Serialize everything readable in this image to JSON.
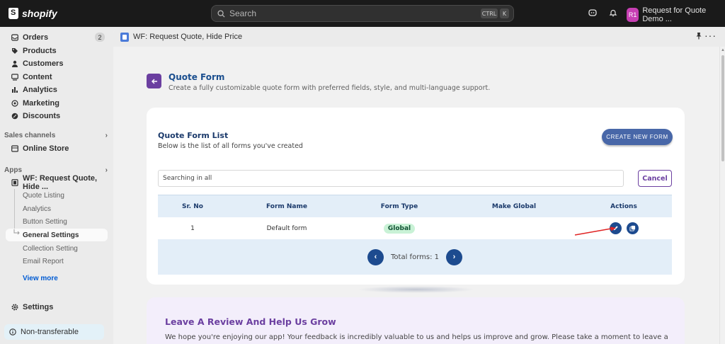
{
  "topbar": {
    "brand": "shopify",
    "search_placeholder": "Search",
    "shortcut_ctrl": "CTRL",
    "shortcut_k": "K",
    "store_initials": "R1",
    "store_name": "Request for Quote Demo ..."
  },
  "sidebar": {
    "nav": [
      {
        "label": "Orders",
        "badge": "2",
        "icon": "inbox-icon"
      },
      {
        "label": "Products",
        "icon": "tag-icon"
      },
      {
        "label": "Customers",
        "icon": "person-icon"
      },
      {
        "label": "Content",
        "icon": "content-icon"
      },
      {
        "label": "Analytics",
        "icon": "bar-chart-icon"
      },
      {
        "label": "Marketing",
        "icon": "target-icon"
      },
      {
        "label": "Discounts",
        "icon": "discount-icon"
      }
    ],
    "sales_channels_title": "Sales channels",
    "online_store": "Online Store",
    "apps_title": "Apps",
    "app_name": "WF: Request Quote, Hide ...",
    "app_subitems": [
      "Quote Listing",
      "Analytics",
      "Button Setting",
      "General Settings",
      "Collection Setting",
      "Email Report"
    ],
    "active_subitem_index": 3,
    "view_more": "View more",
    "settings": "Settings",
    "non_transferable": "Non-transferable"
  },
  "main": {
    "header_title": "WF: Request Quote, Hide Price",
    "quote_form": {
      "title": "Quote Form",
      "description": "Create a fully customizable quote form with preferred fields, style, and multi-language support."
    },
    "list": {
      "title": "Quote Form List",
      "description": "Below is the list of all forms you've created",
      "create_button": "CREATE NEW FORM",
      "search_placeholder": "Searching in all",
      "cancel_button": "Cancel",
      "columns": [
        "Sr. No",
        "Form Name",
        "Form Type",
        "Make Global",
        "Actions"
      ],
      "rows": [
        {
          "sr": "1",
          "name": "Default form",
          "type": "Global"
        }
      ],
      "prev_label": "‹",
      "next_label": "›",
      "total": "Total forms: 1"
    },
    "review": {
      "title": "Leave A Review And Help Us Grow",
      "text": "We hope you're enjoying our app! Your feedback is incredibly valuable to us and helps us improve and grow. Please take a moment to leave a"
    }
  },
  "colors": {
    "accent_purple": "#6b3fa0",
    "primary_blue": "#1d4b8f",
    "badge_green": "#c9f2d6",
    "annotation_arrow": "#e02424"
  }
}
